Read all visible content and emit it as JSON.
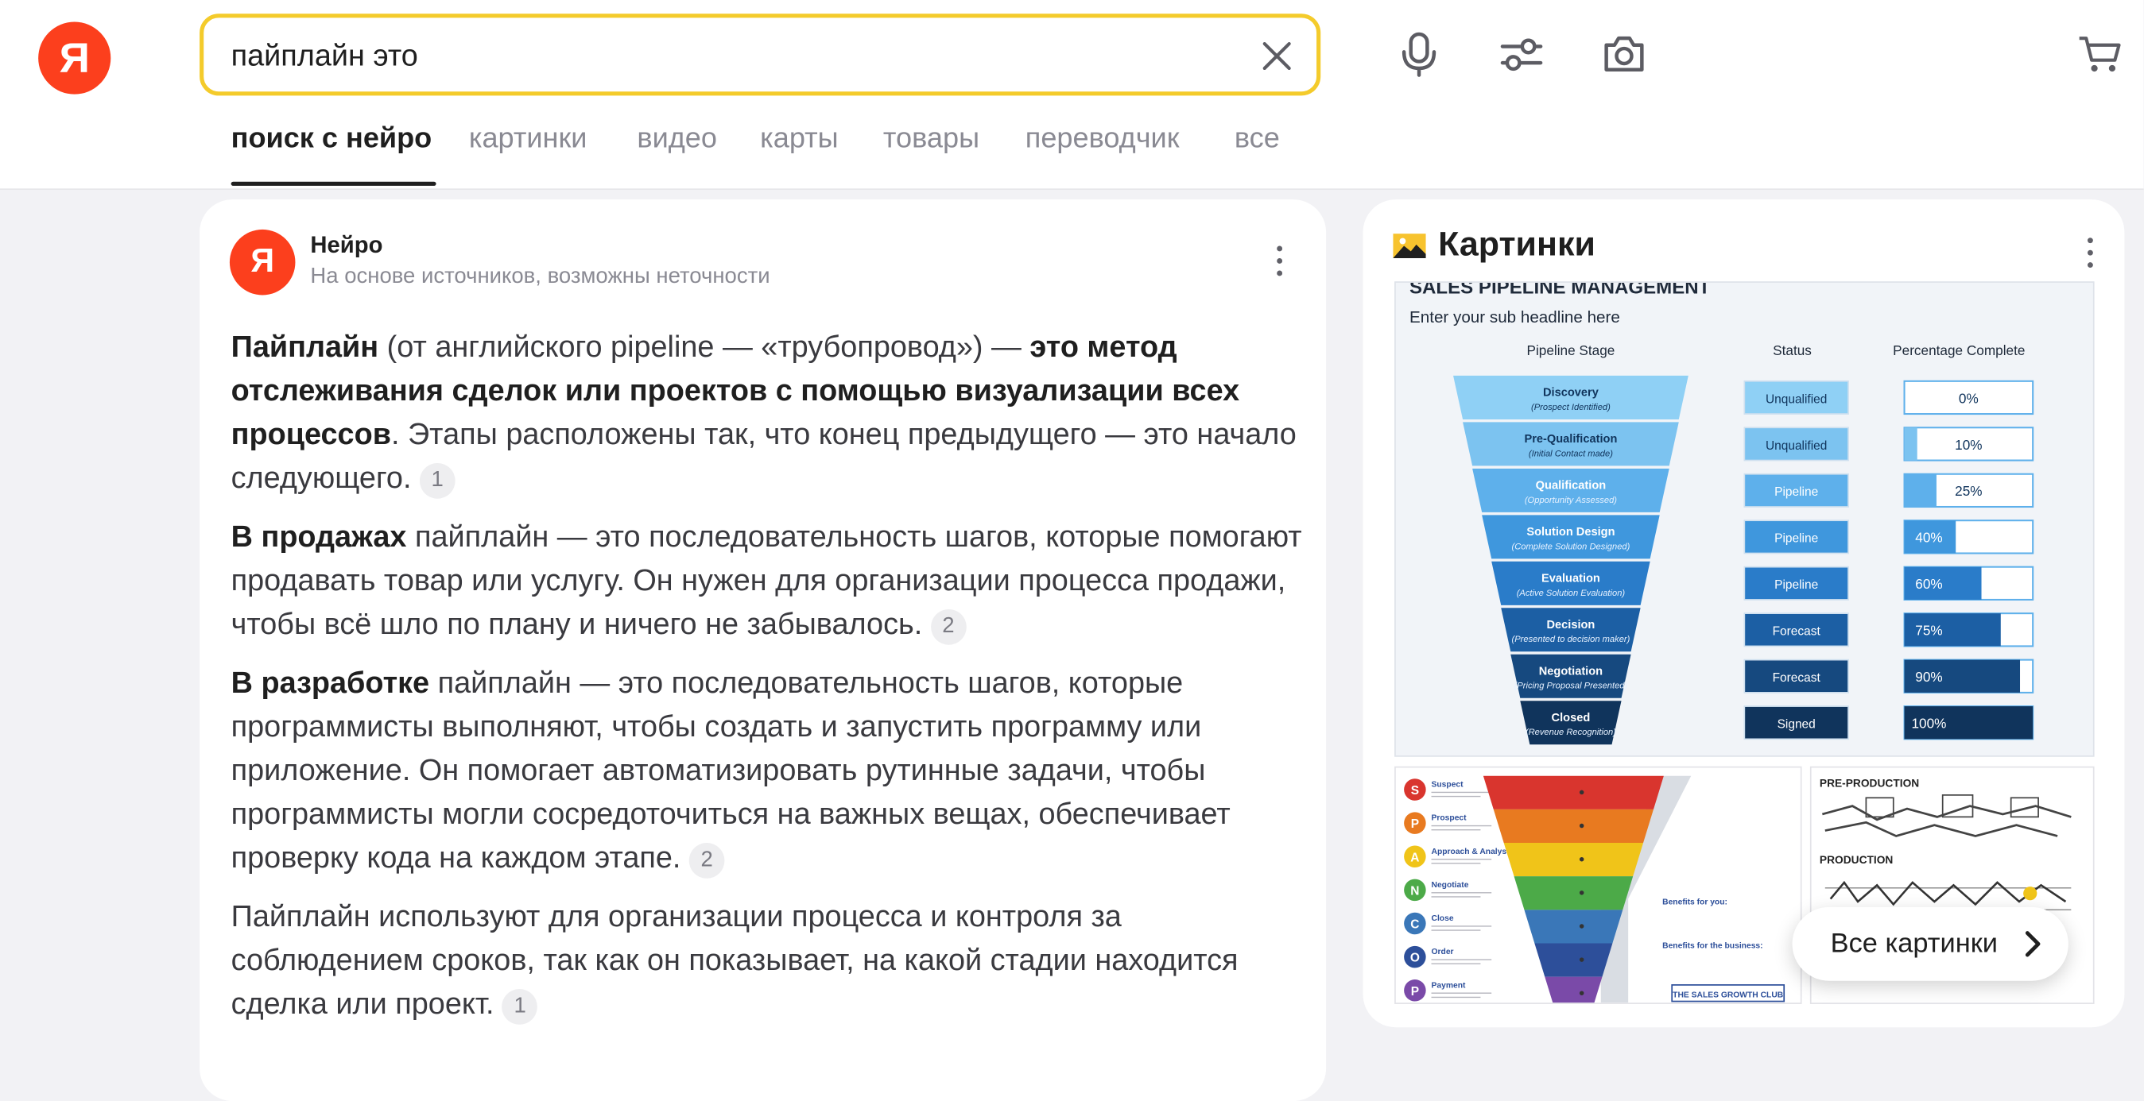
{
  "header": {
    "logo_letter": "Я",
    "search": {
      "value": "пайплайн это",
      "placeholder": ""
    },
    "tabs": [
      {
        "label": "поиск с нейро",
        "active": true
      },
      {
        "label": "картинки"
      },
      {
        "label": "видео"
      },
      {
        "label": "карты"
      },
      {
        "label": "товары"
      },
      {
        "label": "переводчик"
      },
      {
        "label": "все"
      }
    ],
    "icons": [
      "clear-icon",
      "microphone-icon",
      "filters-icon",
      "camera-search-icon",
      "cart-icon"
    ]
  },
  "neuro": {
    "avatar_letter": "Я",
    "title": "Нейро",
    "subtitle": "На основе источников, возможны неточности",
    "paragraphs": [
      {
        "bold_lead": "Пайплайн",
        "text1": " (от английского pipeline — «трубопровод») — ",
        "bold_mid": "это метод отслеживания сделок или проектов с помощью визуализации всех процессов",
        "text2": ". Этапы расположены так, что конец предыдущего — это начало следующего.",
        "ref": "1"
      },
      {
        "bold_lead": "В продажах",
        "text1": " пайплайн — это последовательность шагов, которые помогают продавать товар или услугу. Он нужен для организации процесса продажи, чтобы всё шло по плану и ничего не забывалось.",
        "ref": "2"
      },
      {
        "bold_lead": "В разработке",
        "text1": " пайплайн — это последовательность шагов, которые программисты выполняют, чтобы создать и запустить программу или приложение. Он помогает автоматизировать рутинные задачи, чтобы программисты могли сосредоточиться на важных вещах, обеспечивает проверку кода на каждом этапе.",
        "ref": "2"
      },
      {
        "text1": "Пайплайн используют для организации процесса и контроля за соблюдением сроков, так как он показывает, на какой стадии находится сделка или проект.",
        "ref": "1"
      }
    ]
  },
  "images": {
    "title": "Картинки",
    "all_button": "Все картинки",
    "main": {
      "headline": "SALES PIPELINE MANAGEMENT",
      "subheadline": "Enter your sub headline here",
      "col_stage": "Pipeline Stage",
      "col_status": "Status",
      "col_percent": "Percentage Complete",
      "rows": [
        {
          "stage": "Discovery",
          "note": "(Prospect Identified)",
          "status": "Unqualified",
          "pct": "0%",
          "value": 0
        },
        {
          "stage": "Pre-Qualification",
          "note": "(Initial Contact made)",
          "status": "Unqualified",
          "pct": "10%",
          "value": 10
        },
        {
          "stage": "Qualification",
          "note": "(Opportunity Assessed)",
          "status": "Pipeline",
          "pct": "25%",
          "value": 25
        },
        {
          "stage": "Solution Design",
          "note": "(Complete Solution Designed)",
          "status": "Pipeline",
          "pct": "40%",
          "value": 40
        },
        {
          "stage": "Evaluation",
          "note": "(Active Solution Evaluation)",
          "status": "Pipeline",
          "pct": "60%",
          "value": 60
        },
        {
          "stage": "Decision",
          "note": "(Presented to decision maker)",
          "status": "Forecast",
          "pct": "75%",
          "value": 75
        },
        {
          "stage": "Negotiation",
          "note": "(Pricing Proposal Presented)",
          "status": "Forecast",
          "pct": "90%",
          "value": 90
        },
        {
          "stage": "Closed",
          "note": "(Revenue Recognition)",
          "status": "Signed",
          "pct": "100%",
          "value": 100
        }
      ],
      "colors": [
        "#8fd0f5",
        "#7cc3f0",
        "#5eb0eb",
        "#3f97dd",
        "#2a7cc9",
        "#1c5fa4",
        "#16497f",
        "#10345c"
      ]
    },
    "funnel": {
      "items": [
        {
          "letter": "S",
          "label": "Suspect",
          "color": "#d9352e"
        },
        {
          "letter": "P",
          "label": "Prospect",
          "color": "#e87a20"
        },
        {
          "letter": "A",
          "label": "Approach & Analyse",
          "color": "#f0c419"
        },
        {
          "letter": "N",
          "label": "Negotiate",
          "color": "#4caa48"
        },
        {
          "letter": "C",
          "label": "Close",
          "color": "#3a77b8"
        },
        {
          "letter": "O",
          "label": "Order",
          "color": "#2d4f9a"
        },
        {
          "letter": "P",
          "label": "Payment",
          "color": "#7a4aa8"
        }
      ],
      "benefits_you": "Benefits for you:",
      "benefits_business": "Benefits for the business:",
      "brand": "THE SALES GROWTH CLUB"
    },
    "production": {
      "pre": "PRE-PRODUCTION",
      "prod": "PRODUCTION"
    }
  }
}
